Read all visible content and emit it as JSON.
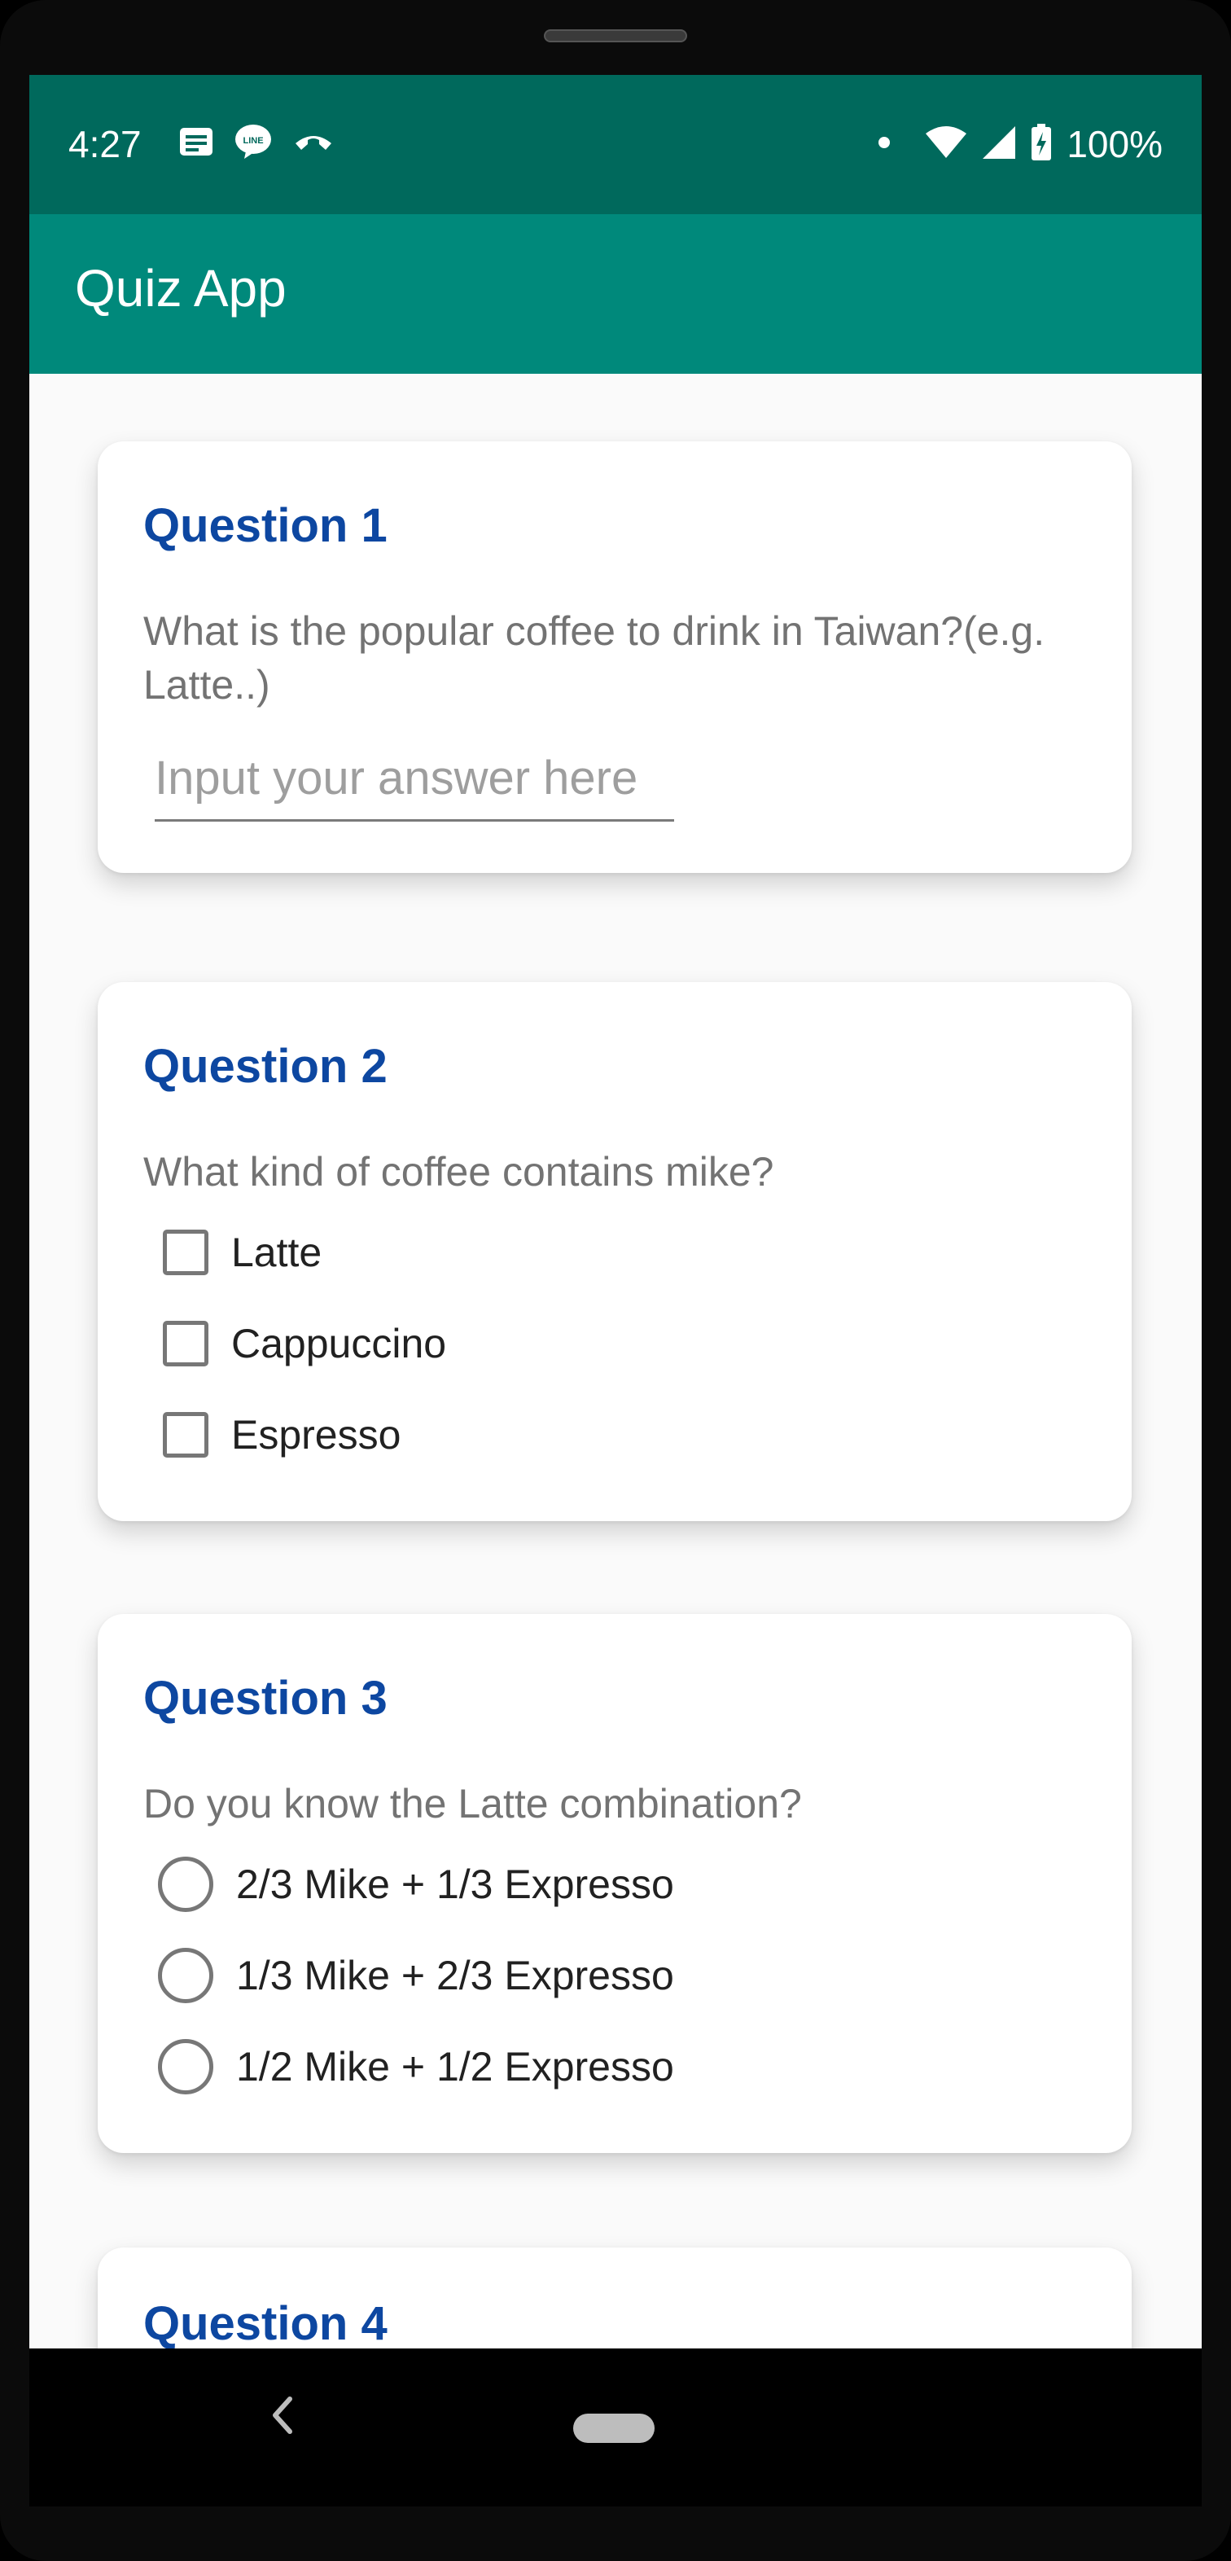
{
  "status_bar": {
    "time": "4:27",
    "left_icons": [
      "message-icon",
      "line-icon",
      "phone-call-icon"
    ],
    "battery": "100%"
  },
  "app_bar": {
    "title": "Quiz App"
  },
  "questions": [
    {
      "title": "Question 1",
      "text": "What is the popular coffee to drink in Taiwan?(e.g. Latte..)",
      "input_value": "",
      "input_placeholder": "Input your answer here"
    },
    {
      "title": "Question 2",
      "text": "What kind of coffee contains mike?",
      "options": [
        "Latte",
        "Cappuccino",
        "Espresso"
      ],
      "checked": [
        false,
        false,
        false
      ]
    },
    {
      "title": "Question 3",
      "text": "Do you know the Latte combination?",
      "options": [
        "2/3 Mike + 1/3 Expresso",
        "1/3 Mike + 2/3 Expresso",
        "1/2 Mike + 1/2 Expresso"
      ],
      "selected": null
    },
    {
      "title": "Question 4"
    }
  ],
  "colors": {
    "status_bar": "#00695c",
    "app_bar": "#00897b",
    "question_title": "#0d47a1"
  }
}
